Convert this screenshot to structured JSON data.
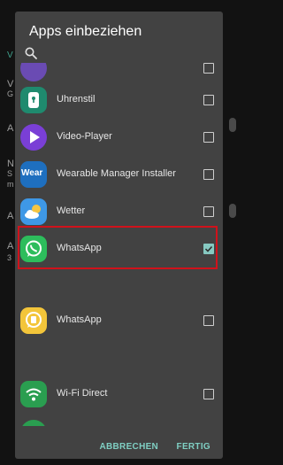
{
  "background": {
    "letters": [
      "V",
      "V",
      "G",
      "A",
      "N",
      "S",
      "m",
      "A",
      "A",
      "3"
    ]
  },
  "dialog": {
    "title": "Apps einbeziehen",
    "search_icon": "search-icon",
    "apps": [
      {
        "label": "",
        "icon": "partial-purple-app-icon",
        "checked": false,
        "partial": true
      },
      {
        "label": "Uhrenstil",
        "icon": "lock-watch-icon",
        "checked": false
      },
      {
        "label": "Video-Player",
        "icon": "play-icon",
        "checked": false
      },
      {
        "label": "Wearable Manager Installer",
        "icon": "wear-icon",
        "icon_text": "Wear",
        "checked": false
      },
      {
        "label": "Wetter",
        "icon": "weather-cloud-sun-icon",
        "checked": false
      },
      {
        "label": "WhatsApp",
        "icon": "whatsapp-icon",
        "checked": true
      },
      {
        "label": "WhatsApp",
        "icon": "whatsapp-business-icon",
        "checked": false
      },
      {
        "label": "Wi-Fi Direct",
        "icon": "wifi-icon",
        "checked": false
      }
    ],
    "cancel_label": "ABBRECHEN",
    "done_label": "FERTIG"
  },
  "colors": {
    "accent": "#7fcfc3",
    "checkbox_checked": "#86c9c1",
    "highlight": "#d0121b",
    "dialog_bg": "#424242"
  }
}
